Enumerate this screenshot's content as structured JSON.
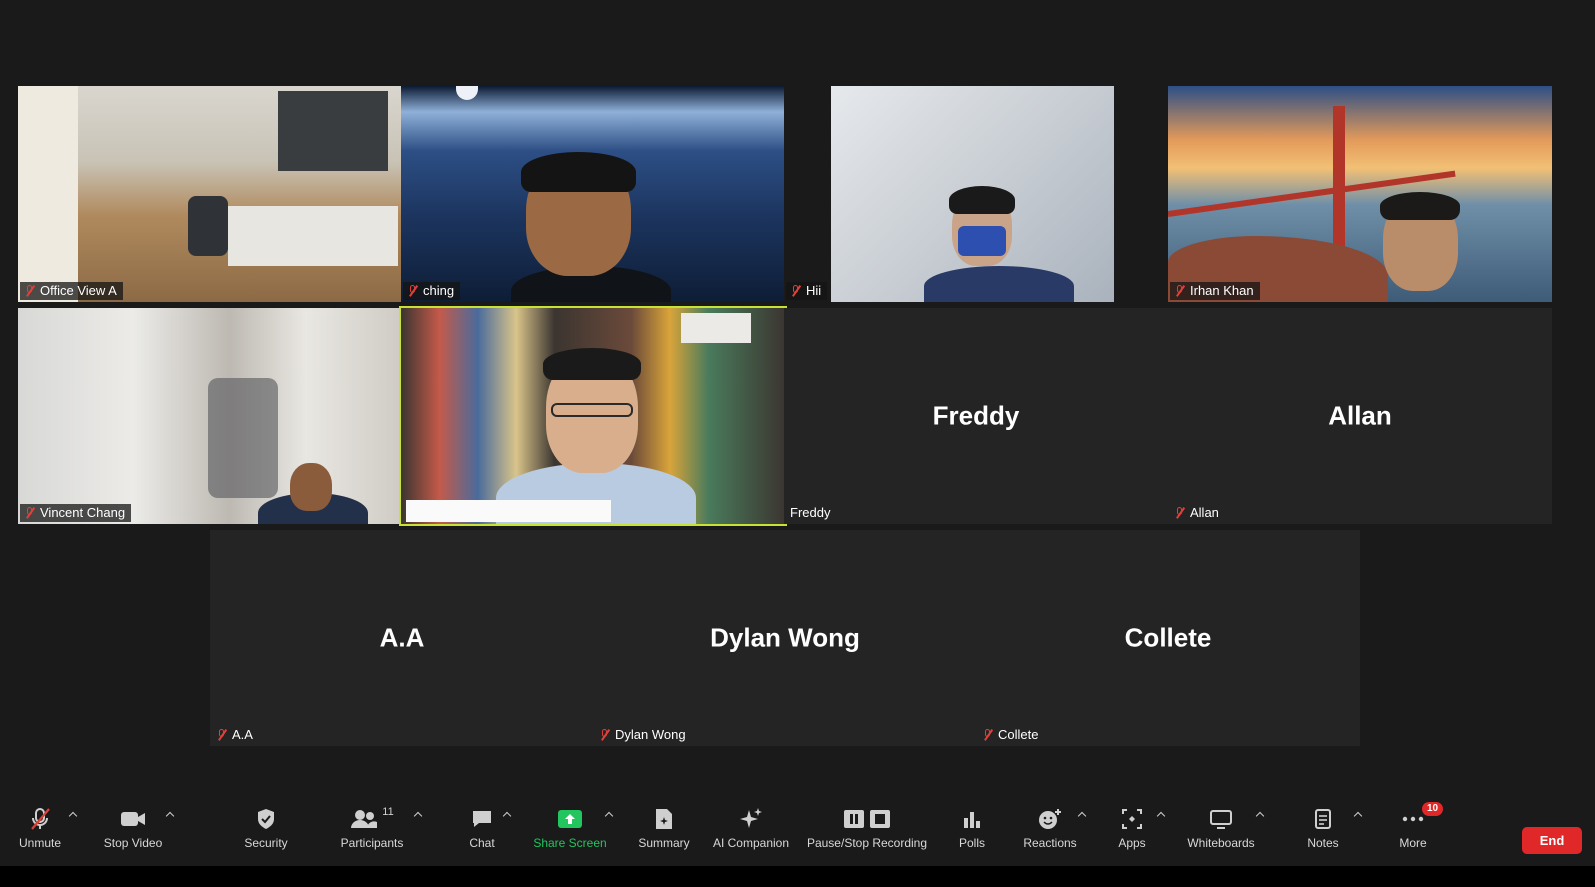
{
  "colors": {
    "active_border": "#c7e234",
    "mic_muted": "#e0403a",
    "share_green": "#22c55e",
    "end_red": "#e02828",
    "tile_bg": "#242424"
  },
  "tiles": {
    "office_view": {
      "name": "Office View A",
      "muted": true
    },
    "ching": {
      "name": "ching",
      "muted": true
    },
    "hii": {
      "name": "Hii",
      "muted": true
    },
    "irhan": {
      "name": "Irhan Khan",
      "muted": true
    },
    "vincent": {
      "name": "Vincent Chang",
      "muted": true
    },
    "active_speaker": {
      "name": "",
      "active": true
    },
    "freddy": {
      "name": "Freddy",
      "center_name": "Freddy",
      "muted": false
    },
    "allan": {
      "name": "Allan",
      "center_name": "Allan",
      "muted": true
    },
    "aa": {
      "name": "A.A",
      "center_name": "A.A",
      "muted": true
    },
    "dylan": {
      "name": "Dylan Wong",
      "center_name": "Dylan Wong",
      "muted": true
    },
    "collete": {
      "name": "Collete",
      "center_name": "Collete",
      "muted": true
    }
  },
  "toolbar": {
    "unmute": "Unmute",
    "stop_video": "Stop Video",
    "security": "Security",
    "participants": "Participants",
    "participants_count": "11",
    "chat": "Chat",
    "share_screen": "Share Screen",
    "summary": "Summary",
    "ai_companion": "AI Companion",
    "recording": "Pause/Stop Recording",
    "polls": "Polls",
    "reactions": "Reactions",
    "apps": "Apps",
    "whiteboards": "Whiteboards",
    "notes": "Notes",
    "more": "More",
    "more_badge": "10",
    "end": "End"
  }
}
